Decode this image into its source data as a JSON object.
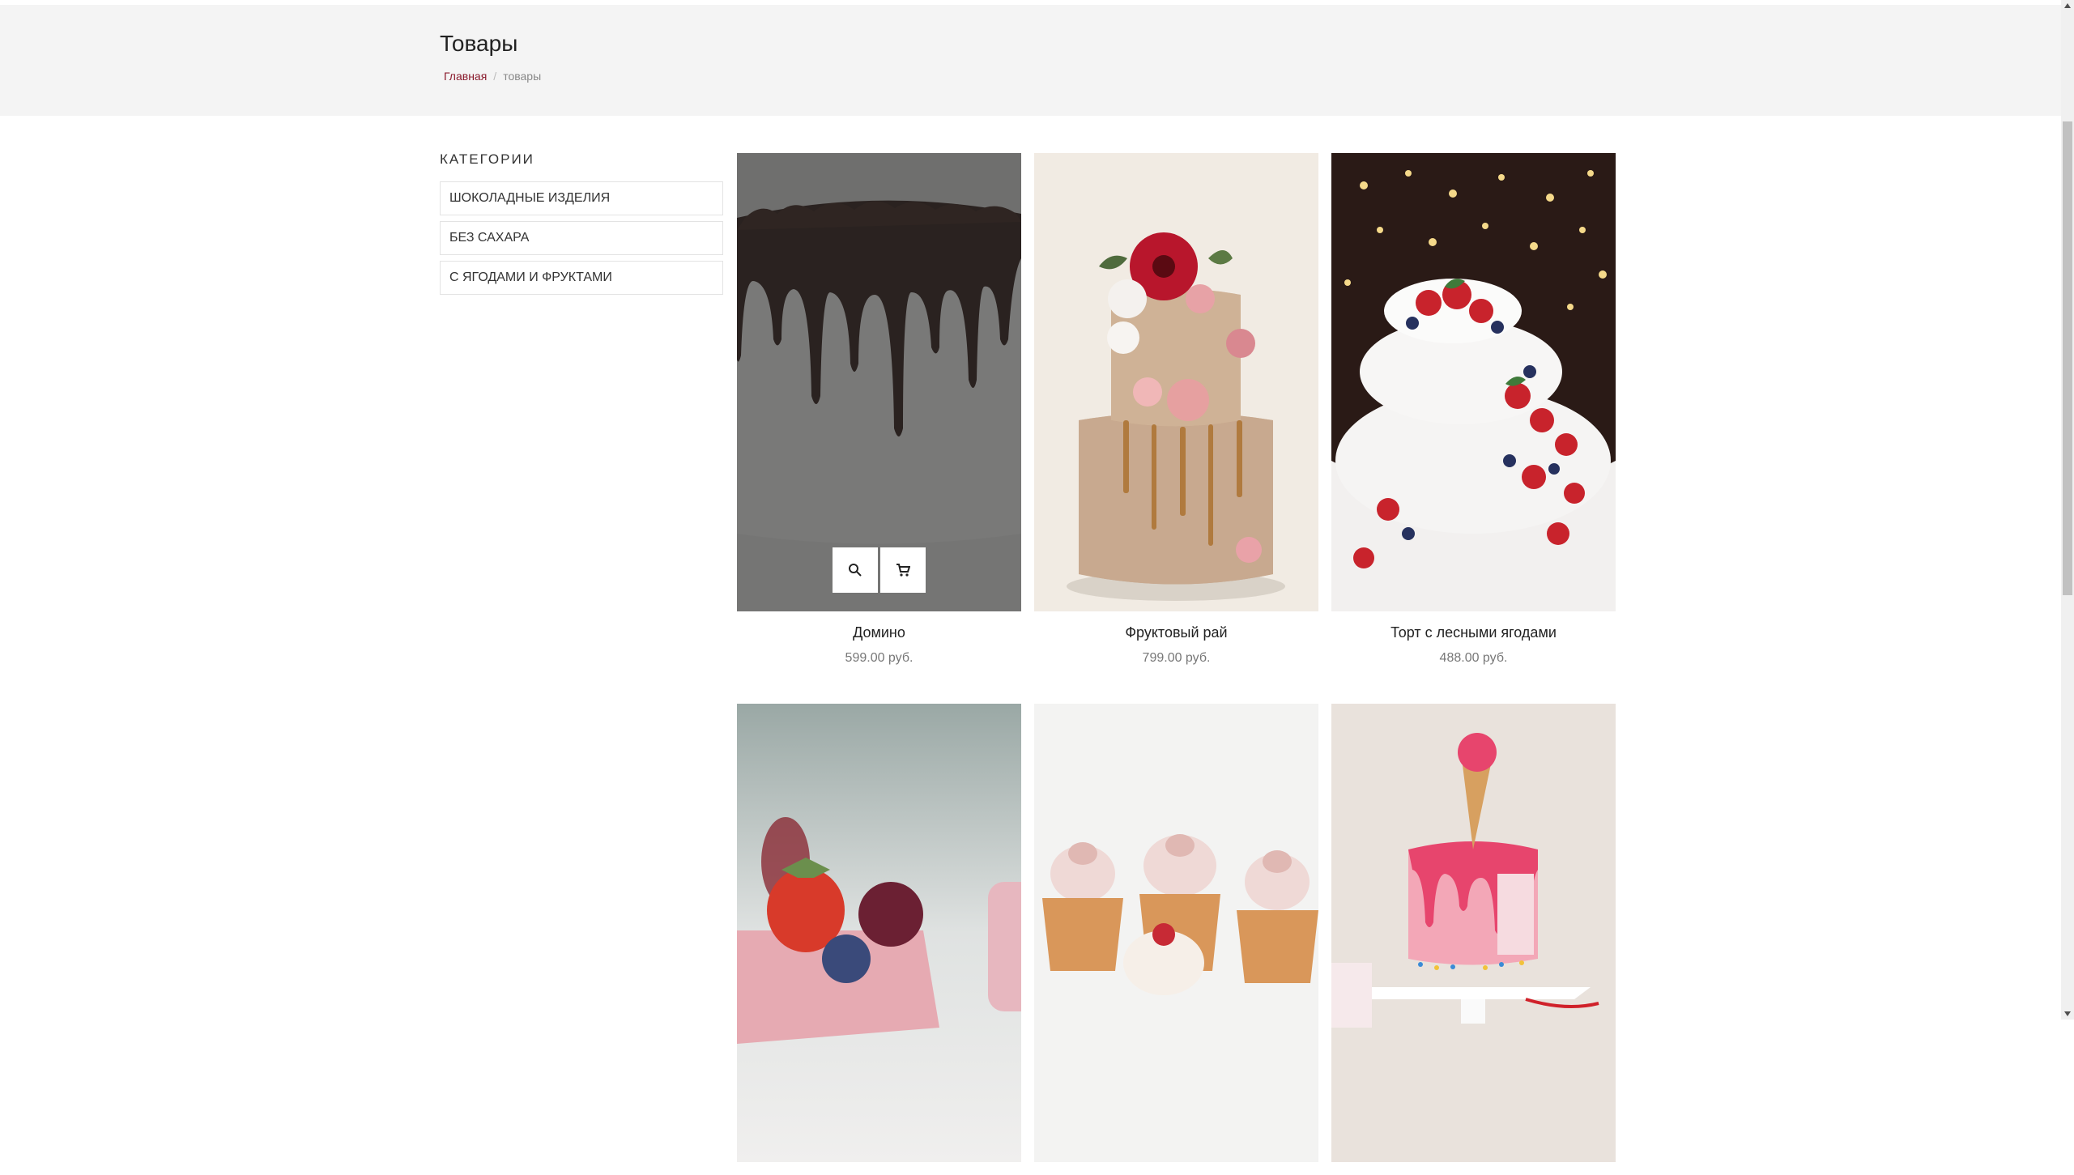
{
  "page": {
    "title": "Товары"
  },
  "breadcrumb": {
    "home": "Главная",
    "separator": "/",
    "current": "товары"
  },
  "categories": {
    "heading": "КАТЕГОРИИ",
    "items": [
      {
        "label": "ШОКОЛАДНЫЕ ИЗДЕЛИЯ"
      },
      {
        "label": "БЕЗ САХАРА"
      },
      {
        "label": "С ЯГОДАМИ И ФРУКТАМИ"
      }
    ]
  },
  "products": [
    {
      "name": "Домино",
      "price": "599.00 руб.",
      "image": "chocolate-drip-cake",
      "hovered": true
    },
    {
      "name": "Фруктовый рай",
      "price": "799.00 руб.",
      "image": "naked-cake-flowers"
    },
    {
      "name": "Торт с лесными ягодами",
      "price": "488.00 руб.",
      "image": "white-berry-cake"
    },
    {
      "name": "",
      "price": "",
      "image": "strawberry-mousse-dessert"
    },
    {
      "name": "",
      "price": "",
      "image": "cupcakes"
    },
    {
      "name": "",
      "price": "",
      "image": "pink-drip-icecream-cake"
    }
  ],
  "product_actions": {
    "quick_view_icon": "search-icon",
    "cart_icon": "cart-icon"
  },
  "colors": {
    "header_band": "#f4f4f4",
    "breadcrumb_home": "#8a1b2d",
    "price": "#777777",
    "scrollbar_thumb": "#c1c1c1"
  }
}
